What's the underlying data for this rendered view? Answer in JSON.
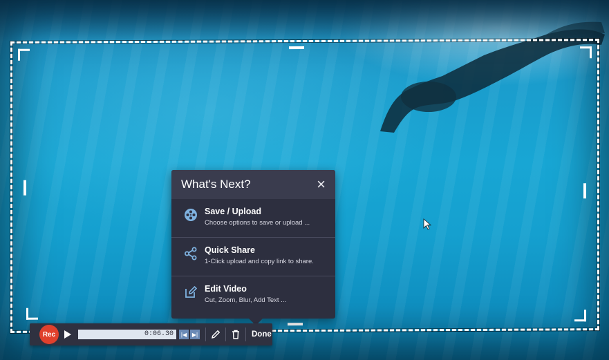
{
  "dialog": {
    "title": "What's Next?",
    "close_symbol": "×",
    "options": [
      {
        "icon": "film-reel-icon",
        "title": "Save / Upload",
        "description": "Choose options to save or upload ..."
      },
      {
        "icon": "share-icon",
        "title": "Quick Share",
        "description": "1-Click upload and copy link to share."
      },
      {
        "icon": "edit-icon",
        "title": "Edit Video",
        "description": "Cut, Zoom, Blur, Add Text ..."
      }
    ]
  },
  "toolbar": {
    "rec_label": "Rec",
    "time": "0:06.30",
    "done_label": "Done",
    "skip_back_symbol": "|◀",
    "skip_forward_symbol": "▶|"
  },
  "colors": {
    "dialog_bg": "#2d2f3f",
    "rec_red": "#e0402c",
    "accent_blue": "#6a8ab6"
  }
}
